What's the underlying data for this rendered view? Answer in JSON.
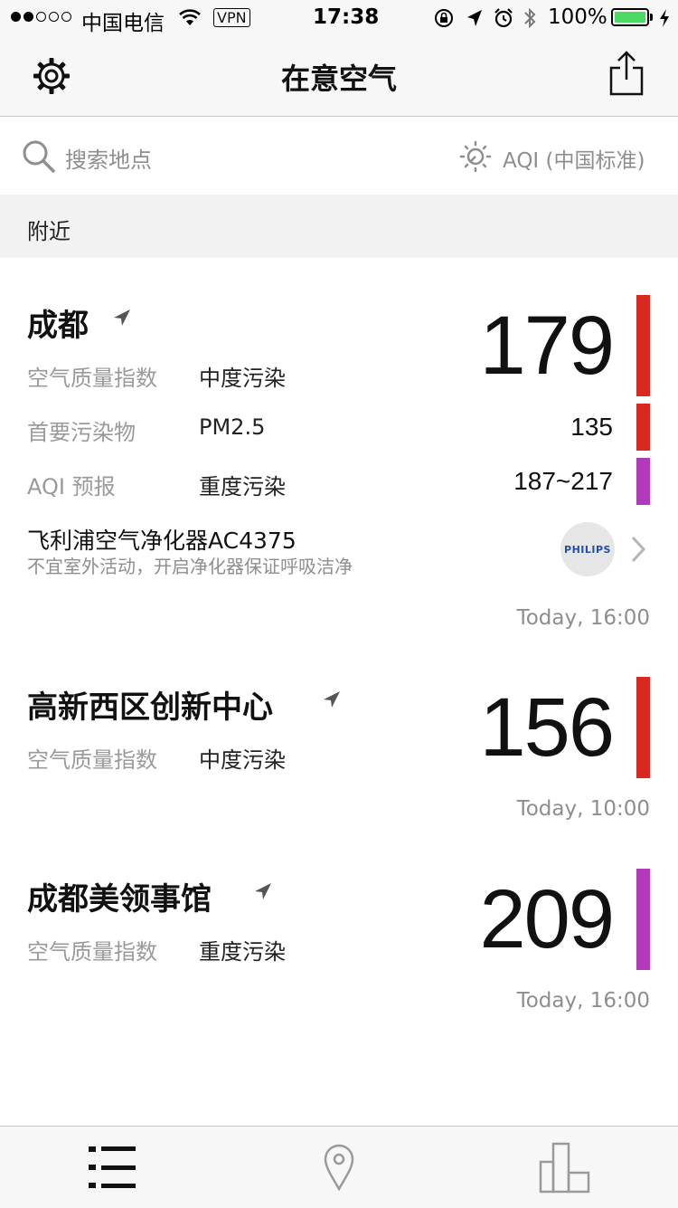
{
  "status_bar": {
    "carrier": "中国电信",
    "vpn": "VPN",
    "time": "17:38",
    "battery": "100%",
    "battery_color": "#4cd964"
  },
  "nav": {
    "title": "在意空气",
    "left_icon": "gear-icon",
    "right_icon": "share-icon"
  },
  "search": {
    "placeholder": "搜索地点",
    "aqi_standard": "AQI (中国标准)"
  },
  "section": {
    "label": "附近"
  },
  "locations": [
    {
      "name": "成都",
      "aqi": "179",
      "quality_label": "空气质量指数",
      "quality_value": "中度污染",
      "pollutant_label": "首要污染物",
      "pollutant_value": "PM2.5",
      "pollutant_number": "135",
      "forecast_label": "AQI 预报",
      "forecast_value": "重度污染",
      "forecast_range": "187~217",
      "promo_title": "飞利浦空气净化器AC4375",
      "promo_subtitle": "不宜室外活动，开启净化器保证呼吸洁净",
      "promo_brand": "PHILIPS",
      "timestamp": "Today, 16:00",
      "colors": {
        "aqi": "#d9281f",
        "pollutant": "#d9281f",
        "forecast": "#b03ab9"
      }
    },
    {
      "name": "高新西区创新中心",
      "aqi": "156",
      "quality_label": "空气质量指数",
      "quality_value": "中度污染",
      "timestamp": "Today, 10:00",
      "colors": {
        "aqi": "#d9281f"
      }
    },
    {
      "name": "成都美领事馆",
      "aqi": "209",
      "quality_label": "空气质量指数",
      "quality_value": "重度污染",
      "timestamp": "Today, 16:00",
      "colors": {
        "aqi": "#b03ab9"
      }
    }
  ],
  "tabbar": {
    "tabs": [
      {
        "icon": "list-icon",
        "selected": true
      },
      {
        "icon": "map-pin-icon",
        "selected": false
      },
      {
        "icon": "bar-chart-icon",
        "selected": false
      }
    ]
  }
}
